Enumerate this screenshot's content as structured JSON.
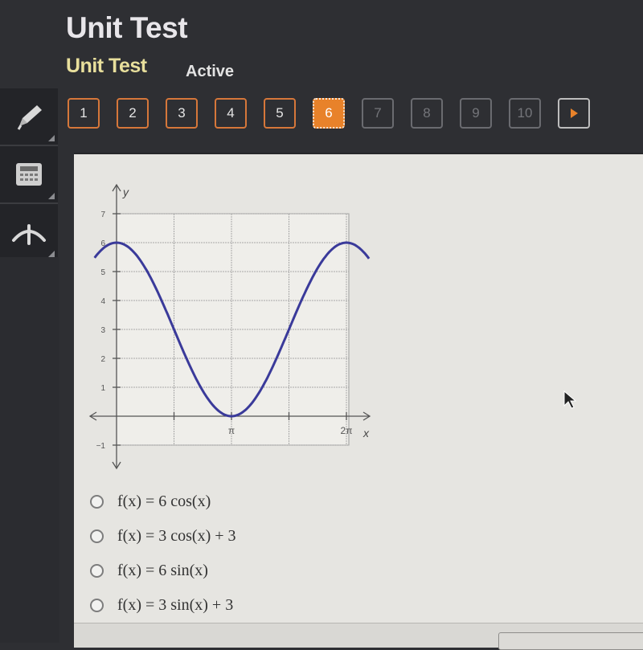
{
  "header": {
    "title": "Unit Test",
    "subtitle": "Unit Test",
    "status": "Active"
  },
  "toolbar": {
    "tools": [
      {
        "name": "pencil-icon"
      },
      {
        "name": "calculator-icon"
      },
      {
        "name": "reference-icon"
      }
    ]
  },
  "navigation": {
    "questions": [
      {
        "label": "1",
        "state": "answered"
      },
      {
        "label": "2",
        "state": "answered"
      },
      {
        "label": "3",
        "state": "answered"
      },
      {
        "label": "4",
        "state": "answered"
      },
      {
        "label": "5",
        "state": "answered"
      },
      {
        "label": "6",
        "state": "current"
      },
      {
        "label": "7",
        "state": "locked"
      },
      {
        "label": "8",
        "state": "locked"
      },
      {
        "label": "9",
        "state": "locked"
      },
      {
        "label": "10",
        "state": "locked"
      }
    ],
    "next_icon": "play-arrow-icon",
    "accent_color": "#e8822a"
  },
  "question": {
    "choices": [
      {
        "label": "f(x) = 6 cos(x)"
      },
      {
        "label": "f(x) = 3 cos(x) + 3"
      },
      {
        "label": "f(x) = 6 sin(x)"
      },
      {
        "label": "f(x) = 3 sin(x) + 3"
      }
    ]
  },
  "chart_data": {
    "type": "line",
    "title": "",
    "xlabel": "x",
    "ylabel": "y",
    "xlim": [
      -0.35,
      6.8
    ],
    "ylim": [
      -1.6,
      7.8
    ],
    "x_ticks": [
      {
        "value": 3.14159,
        "label": "π"
      },
      {
        "value": 6.28318,
        "label": "2π"
      }
    ],
    "y_ticks": [
      {
        "value": -1,
        "label": "−1"
      },
      {
        "value": 1,
        "label": "1"
      },
      {
        "value": 2,
        "label": "2"
      },
      {
        "value": 3,
        "label": "3"
      },
      {
        "value": 4,
        "label": "4"
      },
      {
        "value": 5,
        "label": "5"
      },
      {
        "value": 6,
        "label": "6"
      },
      {
        "value": 7,
        "label": "7"
      }
    ],
    "grid": true,
    "series": [
      {
        "name": "f(x)",
        "function": "3cos(x)+3",
        "x_range": [
          -0.6,
          6.9
        ],
        "color": "#3a3a9a"
      }
    ]
  }
}
